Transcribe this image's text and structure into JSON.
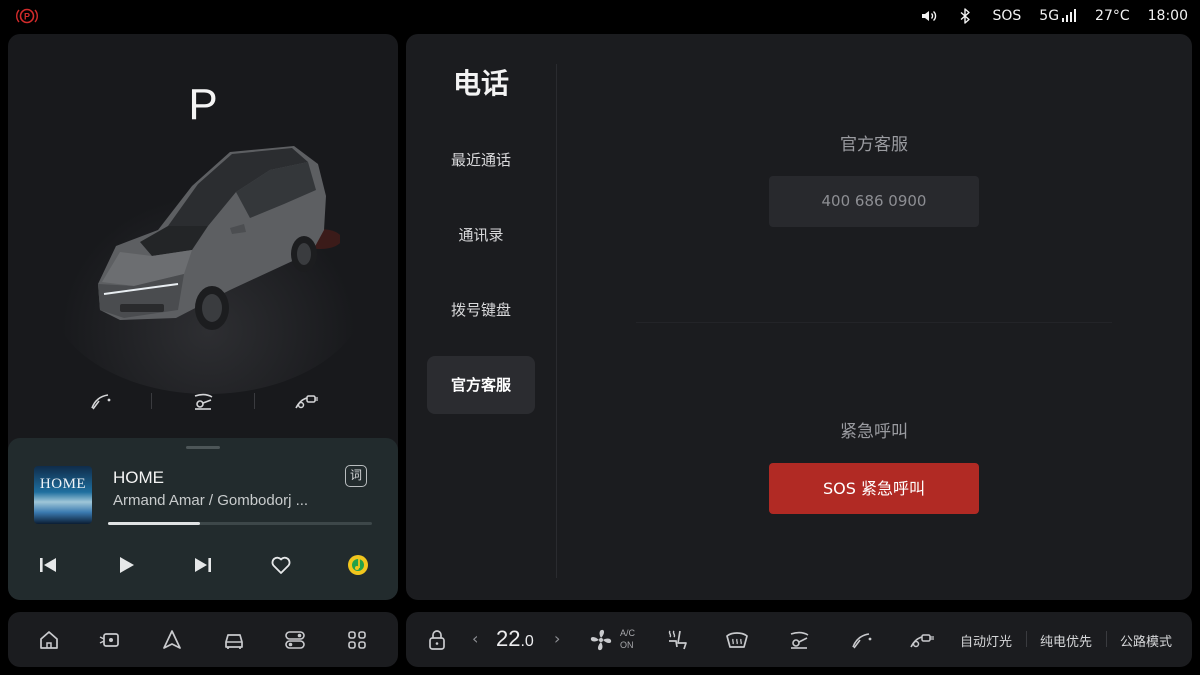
{
  "status_bar": {
    "park_brake_icon": "parking-brake-warning-icon",
    "volume_icon": "volume-icon",
    "bluetooth_icon": "bluetooth-icon",
    "sos_label": "SOS",
    "network_label": "5G",
    "temperature": "27°C",
    "time": "18:00"
  },
  "vehicle": {
    "gear": "P",
    "quick_actions": [
      "wiper-icon",
      "rear-wiper-icon",
      "washer-icon"
    ]
  },
  "music": {
    "album_art_text": "HOME",
    "title": "HOME",
    "artist": "Armand Amar / Gombodorj ...",
    "lyrics_label": "词",
    "progress": 0.35,
    "controls": [
      "previous-icon",
      "play-icon",
      "next-icon",
      "favorite-icon",
      "qq-music-icon"
    ]
  },
  "phone": {
    "title": "电话",
    "nav": [
      {
        "label": "最近通话",
        "active": false
      },
      {
        "label": "通讯录",
        "active": false
      },
      {
        "label": "拨号键盘",
        "active": false
      },
      {
        "label": "官方客服",
        "active": true
      }
    ],
    "service_label": "官方客服",
    "service_number": "400 686 0900",
    "emergency_label": "紧急呼叫",
    "sos_button": "SOS 紧急呼叫"
  },
  "dock_left": [
    "home-icon",
    "camera-icon",
    "navigation-icon",
    "car-icon",
    "toggles-icon",
    "apps-icon"
  ],
  "dock_right": {
    "lock_icon": "lock-icon",
    "temp_whole": "22",
    "temp_decimal": ".0",
    "ac_line1": "A/C",
    "ac_line2": "ON",
    "modes": [
      "自动灯光",
      "纯电优先",
      "公路模式"
    ]
  },
  "colors": {
    "panel": "#1b1c1f",
    "music_card": "#222b2d",
    "sos_red": "#b12a24",
    "park_brake_red": "#d22b2b"
  }
}
